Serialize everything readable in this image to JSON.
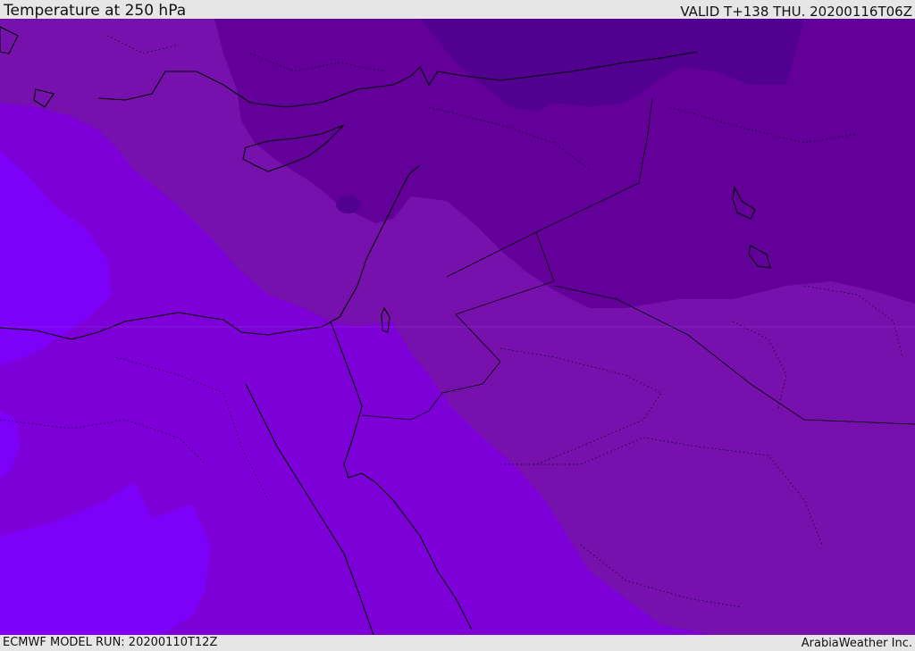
{
  "header": {
    "title": "Temperature at 250 hPa",
    "valid": "VALID T+138 THU. 20200116T06Z"
  },
  "footer": {
    "model_run": "ECMWF MODEL RUN: 20200110T12Z",
    "credit": "ArabiaWeather Inc."
  },
  "map": {
    "colors": {
      "band_coldest": "#52008f",
      "band_cold": "#63009a",
      "band_mid": "#7711ad",
      "band_warm": "#7e00d8",
      "band_warmest": "#7d00f8",
      "coastline": "#000000"
    }
  }
}
